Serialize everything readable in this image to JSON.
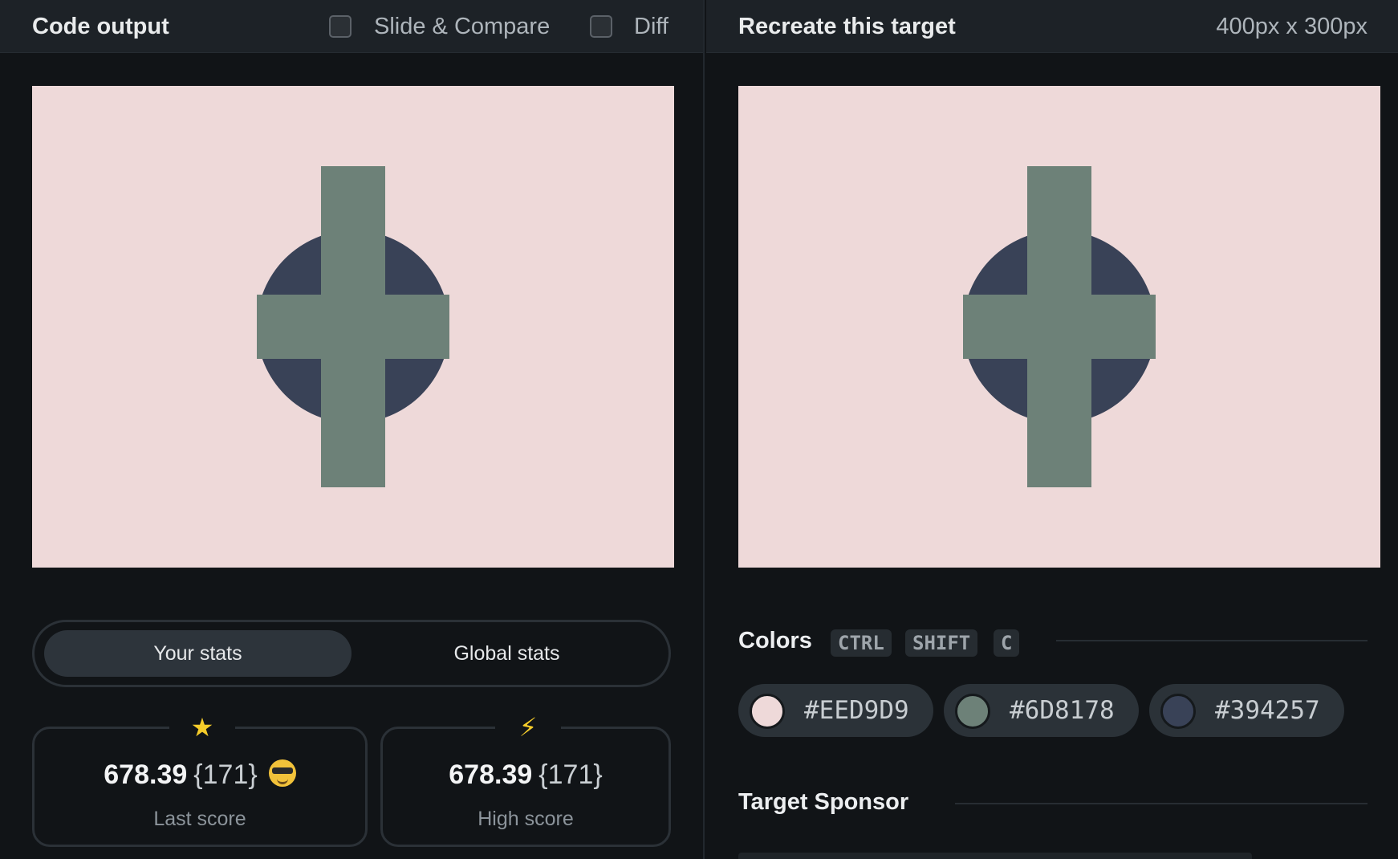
{
  "left": {
    "title": "Code output",
    "options": [
      {
        "label": "Slide & Compare",
        "checked": false
      },
      {
        "label": "Diff",
        "checked": false
      }
    ],
    "stats_tabs": [
      {
        "label": "Your stats",
        "active": true
      },
      {
        "label": "Global stats",
        "active": false
      }
    ],
    "last_score": {
      "icon": "star-icon",
      "value": "678.39",
      "count": "{171}",
      "emoji": "sunglasses-emoji-icon",
      "label": "Last score"
    },
    "high_score": {
      "icon": "lightning-icon",
      "value": "678.39",
      "count": "{171}",
      "label": "High score"
    }
  },
  "right": {
    "title": "Recreate this target",
    "dimensions": "400px x 300px",
    "colors_title": "Colors",
    "shortcut_keys": [
      "CTRL",
      "SHIFT",
      "C"
    ],
    "colors": [
      "#EED9D9",
      "#6D8178",
      "#394257"
    ],
    "sponsor_title": "Target Sponsor"
  },
  "target_colors": {
    "background": "#eed9d9",
    "cross": "#6d8178",
    "circle": "#394257"
  }
}
